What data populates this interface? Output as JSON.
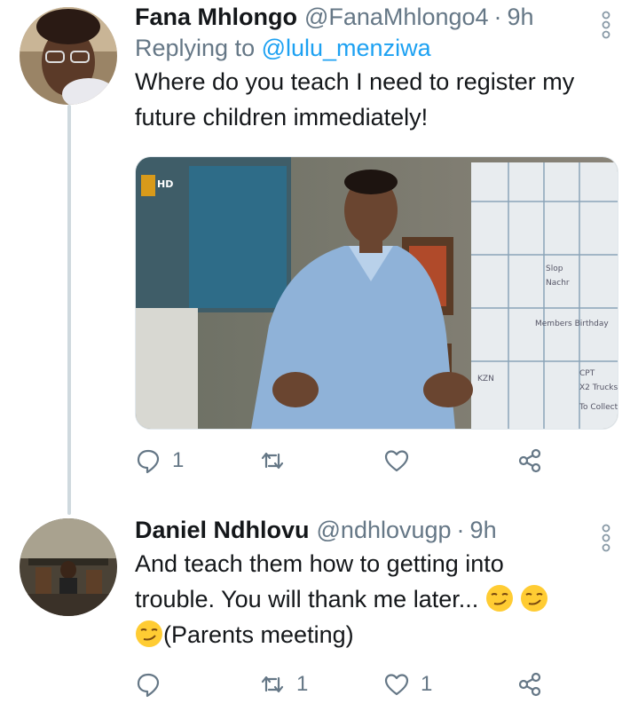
{
  "tweets": [
    {
      "name": "Fana Mhlongo",
      "handle": "@FanaMhlongo4",
      "time": "9h",
      "replying_prefix": "Replying to ",
      "replying_to": "@lulu_menziwa",
      "text_line1": "Where do you teach I need to register my",
      "text_line2": "future children immediately!",
      "media_badge": "HD",
      "whiteboard_notes": [
        "Slop",
        "Nachr",
        "Members Birthday",
        "KZN",
        "CPT",
        "X2 Trucks",
        "To Collect"
      ],
      "actions": {
        "reply_count": "1",
        "retweet_count": "",
        "like_count": ""
      }
    },
    {
      "name": "Daniel Ndhlovu",
      "handle": "@ndhlovugp",
      "time": "9h",
      "text_line1": "And teach them how to getting into",
      "text_line2": "trouble. You will thank me later...",
      "text_line3": "(Parents meeting)",
      "actions": {
        "reply_count": "",
        "retweet_count": "1",
        "like_count": "1"
      }
    }
  ],
  "icons": [
    "reply-icon",
    "retweet-icon",
    "like-icon",
    "share-icon",
    "more-icon",
    "smirk-emoji-icon"
  ],
  "colors": {
    "text": "#14171a",
    "muted": "#657786",
    "link": "#1da1f2",
    "thread_line": "#cfd9de"
  }
}
